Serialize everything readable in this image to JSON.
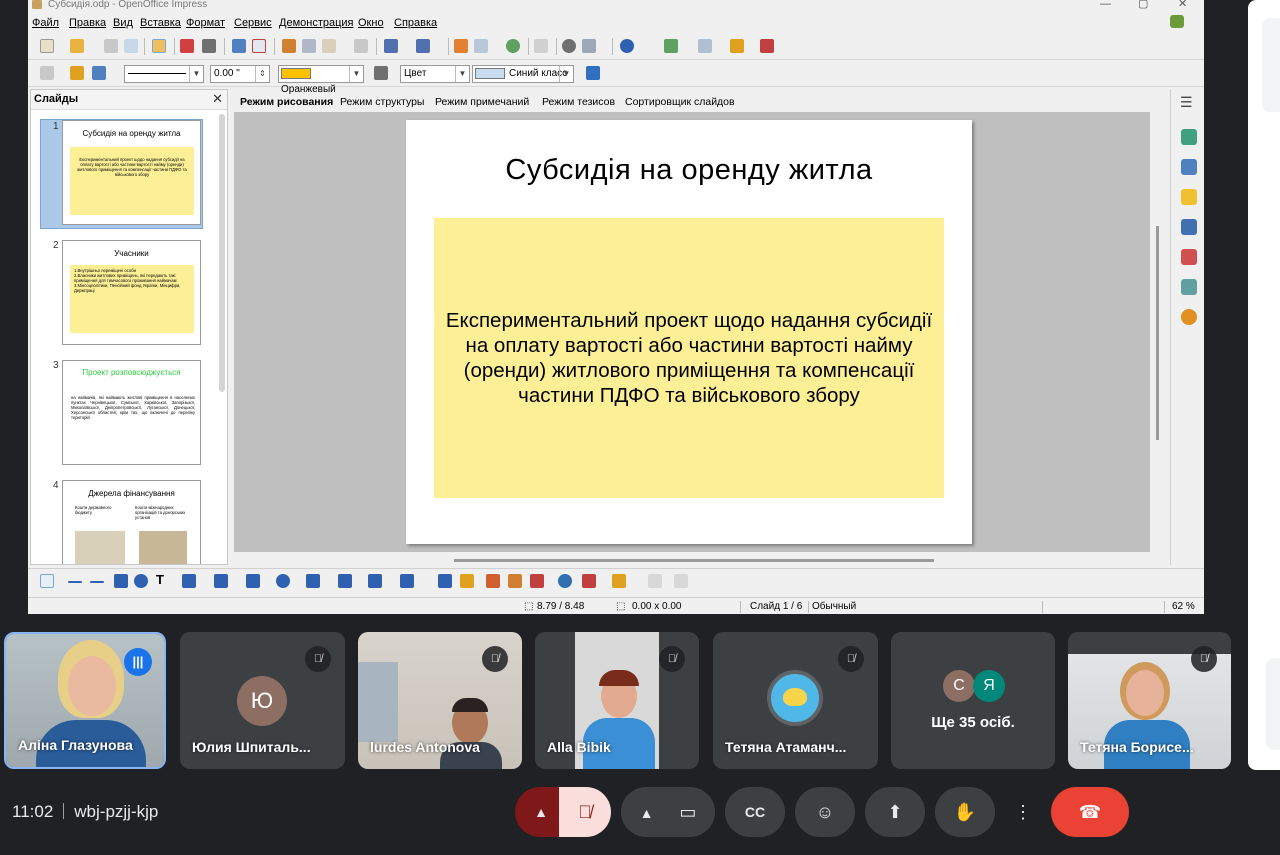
{
  "window": {
    "title": "Субсидія.odp - OpenOffice Impress",
    "menu": [
      "Файл",
      "Правка",
      "Вид",
      "Вставка",
      "Формат",
      "Сервис",
      "Демонстрация",
      "Окно",
      "Справка"
    ]
  },
  "line_toolbar": {
    "line_width": "0.00 \"",
    "fill_color": "Оранжевый",
    "color_mode": "Цвет",
    "area_color": "Синий класс"
  },
  "slides_panel": {
    "title": "Слайды",
    "slides": [
      {
        "number": "1",
        "title": "Субсидія на оренду житла",
        "body": "Експериментальний проект щодо надання субсидії на оплату вартості або частини вартості найму (оренди) житлового приміщення та компенсації частини ПДФО та військового збору"
      },
      {
        "number": "2",
        "title": "Учасники",
        "bullets": [
          "1.Внутрішньо переміщені особи",
          "2.Власники житлових приміщень, які передають такі приміщення для тимчасового проживання наймачам",
          "3.Мінсоцполітики, Пенсійний фонд України, Мінцифри, Держпраці"
        ]
      },
      {
        "number": "3",
        "title": "Проект розповсюджується",
        "body": "на наймачів, які наймають житлові приміщення в населених пунктах Чернівецької, Сумської, Харківської, Запорізької, Миколаївської, Дніпропетровської, Луганської, Донецької, Херсонської областей, крім тих, що включені до переліку територій."
      },
      {
        "number": "4",
        "title": "Джерела фінансування",
        "bullets": [
          "Кошти державного бюджету",
          "Кошти міжнародних організацій та донорських установ"
        ]
      }
    ]
  },
  "view_tabs": [
    "Режим рисования",
    "Режим структуры",
    "Режим примечаний",
    "Режим тезисов",
    "Сортировщик слайдов"
  ],
  "main_slide": {
    "title": "Субсидія на оренду житла",
    "body": "Експериментальний проект щодо надання субсидії на оплату вартості або частини вартості найму (оренди) житлового приміщення та компенсації частини ПДФО та військового збору"
  },
  "status": {
    "position": "8.79 / 8.48",
    "size": "0.00 x 0.00",
    "slide": "Слайд 1 / 6",
    "layout": "Обычный",
    "zoom": "62 %"
  },
  "participants": [
    {
      "name": "Аліна Глазунова",
      "speaking": true
    },
    {
      "name": "Юлия Шпиталь...",
      "initial": "Ю",
      "muted": true
    },
    {
      "name": "lurdes Antonova",
      "muted": true
    },
    {
      "name": "Alla Bibik",
      "muted": true
    },
    {
      "name": "Тетяна Атаманч...",
      "muted": true
    },
    {
      "name": "Ще 35 осіб.",
      "initials": [
        "С",
        "Я"
      ]
    },
    {
      "name": "Тетяна Борисе...",
      "muted": true
    }
  ],
  "meeting": {
    "time": "11:02",
    "code": "wbj-pzjj-kjp"
  },
  "colors": {
    "slide_box": "#fcef96",
    "meet_bg": "#202124",
    "leave": "#ea4335",
    "speaking": "#1a73e8"
  }
}
